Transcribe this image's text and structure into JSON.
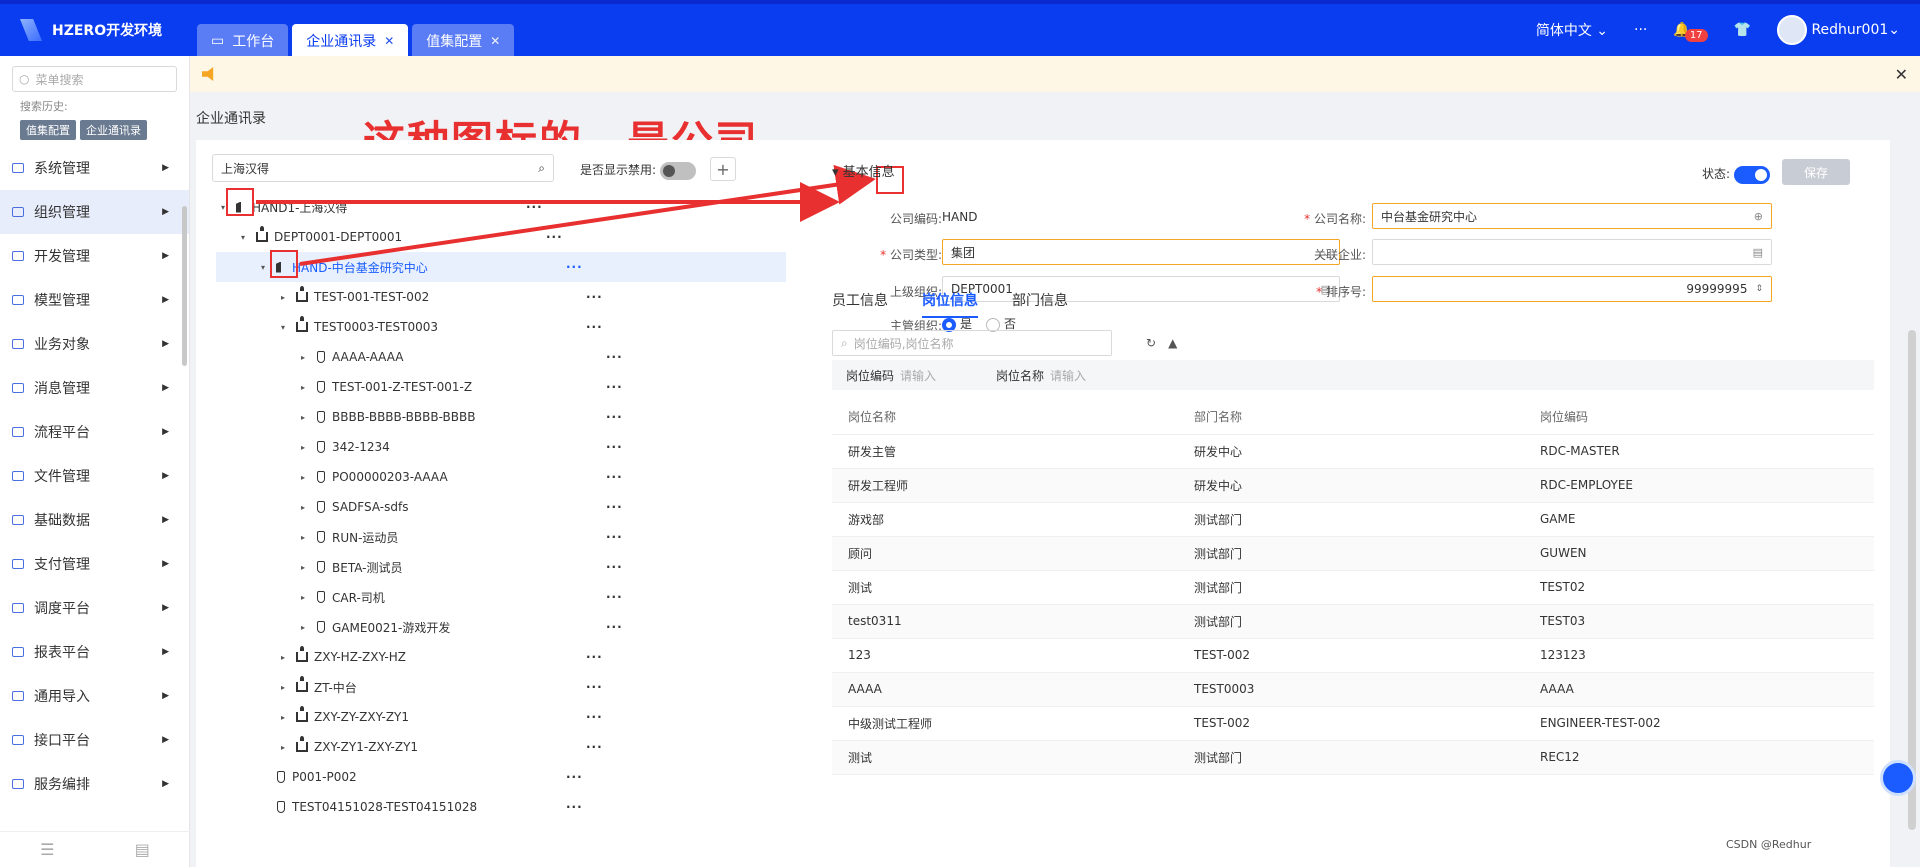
{
  "header": {
    "brand": "HZERO开发环境",
    "tabs": [
      {
        "label": "工作台",
        "active": false,
        "closable": false
      },
      {
        "label": "企业通讯录",
        "active": true,
        "closable": true
      },
      {
        "label": "值集配置",
        "active": false,
        "closable": true
      }
    ],
    "language": "简体中文",
    "notification_count": "17",
    "username": "Redhur001"
  },
  "sidebar": {
    "search_placeholder": "菜单搜索",
    "history_label": "搜索历史:",
    "history": [
      "值集配置",
      "企业通讯录"
    ],
    "items": [
      {
        "label": "系统管理"
      },
      {
        "label": "组织管理",
        "active": true
      },
      {
        "label": "开发管理"
      },
      {
        "label": "模型管理"
      },
      {
        "label": "业务对象"
      },
      {
        "label": "消息管理"
      },
      {
        "label": "流程平台"
      },
      {
        "label": "文件管理"
      },
      {
        "label": "基础数据"
      },
      {
        "label": "支付管理"
      },
      {
        "label": "调度平台"
      },
      {
        "label": "报表平台"
      },
      {
        "label": "通用导入"
      },
      {
        "label": "接口平台"
      },
      {
        "label": "服务编排"
      }
    ]
  },
  "page": {
    "title": "企业通讯录",
    "annotation": "这种图标的，是公司"
  },
  "tree": {
    "search_value": "上海汉得",
    "show_disabled_label": "是否显示禁用:",
    "nodes": [
      {
        "label": "HAND1-上海汉得",
        "type": "company",
        "level": 0,
        "caret": "▾"
      },
      {
        "label": "DEPT0001-DEPT0001",
        "type": "dept",
        "level": 1,
        "caret": "▾"
      },
      {
        "label": "HAND-中台基金研究中心",
        "type": "company",
        "level": 2,
        "caret": "▾",
        "selected": true
      },
      {
        "label": "TEST-001-TEST-002",
        "type": "dept",
        "level": 3,
        "caret": "▸"
      },
      {
        "label": "TEST0003-TEST0003",
        "type": "dept",
        "level": 3,
        "caret": "▾"
      },
      {
        "label": "AAAA-AAAA",
        "type": "pos",
        "level": 4,
        "caret": "▸"
      },
      {
        "label": "TEST-001-Z-TEST-001-Z",
        "type": "pos",
        "level": 4,
        "caret": "▸"
      },
      {
        "label": "BBBB-BBBB-BBBB-BBBB",
        "type": "pos",
        "level": 4,
        "caret": "▸"
      },
      {
        "label": "342-1234",
        "type": "pos",
        "level": 4,
        "caret": "▸"
      },
      {
        "label": "PO00000203-AAAA",
        "type": "pos",
        "level": 4,
        "caret": "▸"
      },
      {
        "label": "SADFSA-sdfs",
        "type": "pos",
        "level": 4,
        "caret": "▸"
      },
      {
        "label": "RUN-运动员",
        "type": "pos",
        "level": 4,
        "caret": "▸"
      },
      {
        "label": "BETA-测试员",
        "type": "pos",
        "level": 4,
        "caret": "▸"
      },
      {
        "label": "CAR-司机",
        "type": "pos",
        "level": 4,
        "caret": "▸"
      },
      {
        "label": "GAME0021-游戏开发",
        "type": "pos",
        "level": 4,
        "caret": "▸"
      },
      {
        "label": "ZXY-HZ-ZXY-HZ",
        "type": "dept",
        "level": 3,
        "caret": "▸"
      },
      {
        "label": "ZT-中台",
        "type": "dept",
        "level": 3,
        "caret": "▸"
      },
      {
        "label": "ZXY-ZY-ZXY-ZY1",
        "type": "dept",
        "level": 3,
        "caret": "▸"
      },
      {
        "label": "ZXY-ZY1-ZXY-ZY1",
        "type": "dept",
        "level": 3,
        "caret": "▸"
      },
      {
        "label": "P001-P002",
        "type": "pos",
        "level": 2,
        "caret": ""
      },
      {
        "label": "TEST04151028-TEST04151028",
        "type": "pos",
        "level": 2,
        "caret": ""
      }
    ]
  },
  "form": {
    "section_title": "基本信息",
    "status_label": "状态:",
    "status_on": true,
    "save_label": "保存",
    "company_code_label": "公司编码:",
    "company_code": "HAND",
    "company_name_label": "公司名称:",
    "company_name": "中台基金研究中心",
    "company_type_label": "公司类型:",
    "company_type": "集团",
    "related_label": "关联企业:",
    "related_value": "",
    "parent_label": "上级组织:",
    "parent_value": "DEPT0001",
    "sort_label": "排序号:",
    "sort_value": "99999995",
    "main_org_label": "主管组织:",
    "yes_label": "是",
    "no_label": "否",
    "main_org_yes": true
  },
  "subtabs": [
    "员工信息",
    "岗位信息",
    "部门信息"
  ],
  "positions": {
    "search_placeholder": "岗位编码,岗位名称",
    "filter_code_label": "岗位编码",
    "filter_name_label": "岗位名称",
    "filter_placeholder": "请输入",
    "columns": [
      "岗位名称",
      "部门名称",
      "岗位编码"
    ],
    "rows": [
      [
        "研发主管",
        "研发中心",
        "RDC-MASTER"
      ],
      [
        "研发工程师",
        "研发中心",
        "RDC-EMPLOYEE"
      ],
      [
        "游戏部",
        "测试部门",
        "GAME"
      ],
      [
        "顾问",
        "测试部门",
        "GUWEN"
      ],
      [
        "测试",
        "测试部门",
        "TEST02"
      ],
      [
        "test0311",
        "测试部门",
        "TEST03"
      ],
      [
        "123",
        "TEST-002",
        "123123"
      ],
      [
        "AAAA",
        "TEST0003",
        "AAAA"
      ],
      [
        "中级测试工程师",
        "TEST-002",
        "ENGINEER-TEST-002"
      ],
      [
        "测试",
        "测试部门",
        "REC12"
      ]
    ]
  },
  "footer_watermark": "CSDN @Redhur",
  "colors": {
    "primary": "#0a3cf0",
    "accent": "#1a5cff",
    "annotation": "#e83030"
  }
}
